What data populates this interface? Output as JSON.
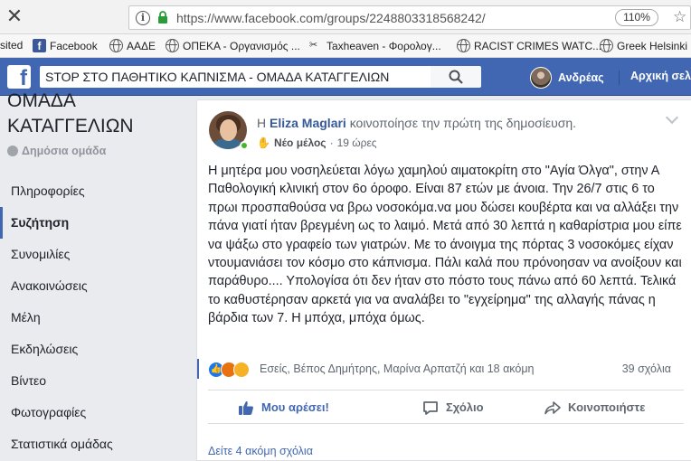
{
  "browser": {
    "url": "https://www.facebook.com/groups/2248803318568242/",
    "zoom": "110%",
    "bookmarks": [
      {
        "label": "sited",
        "icon": "none"
      },
      {
        "label": "Facebook",
        "icon": "facebook-icon"
      },
      {
        "label": "ΑΑΔΕ",
        "icon": "globe-icon"
      },
      {
        "label": "ΟΠΕΚΑ - Οργανισμός ...",
        "icon": "globe-icon"
      },
      {
        "label": "Taxheaven - Φορολογ...",
        "icon": "taxheaven-icon"
      },
      {
        "label": "RACIST CRIMES WATC...",
        "icon": "globe-icon"
      },
      {
        "label": "Greek Helsinki M",
        "icon": "globe-icon"
      }
    ]
  },
  "topbar": {
    "logo": "f",
    "search_value": "STOP ΣΤΟ ΠΑΘΗΤΙΚΟ ΚΑΠΝΙΣΜΑ - ΟΜΑΔΑ ΚΑΤΑΓΓΕΛΙΩΝ",
    "user_name": "Ανδρέας",
    "home_label": "Αρχική σελ",
    "brand_color": "#4267b2"
  },
  "sidebar": {
    "group_title": "ΟΜΑΔΑ ΚΑΤΑΓΓΕΛΙΩΝ",
    "group_type": "Δημόσια ομάδα",
    "items": [
      {
        "label": "Πληροφορίες",
        "active": false
      },
      {
        "label": "Συζήτηση",
        "active": true
      },
      {
        "label": "Συνομιλίες",
        "active": false
      },
      {
        "label": "Ανακοινώσεις",
        "active": false
      },
      {
        "label": "Μέλη",
        "active": false
      },
      {
        "label": "Εκδηλώσεις",
        "active": false
      },
      {
        "label": "Βίντεο",
        "active": false
      },
      {
        "label": "Φωτογραφίες",
        "active": false
      },
      {
        "label": "Στατιστικά ομάδας",
        "active": false
      }
    ]
  },
  "post": {
    "prefix": "Η",
    "author": "Eliza Maglari",
    "action_text": "κοινοποίησε την πρώτη της δημοσίευση.",
    "badge": "Νέο μέλος",
    "separator": "·",
    "time": "19 ώρες",
    "body": "Η μητέρα μου νοσηλεύεται λόγω χαμηλού αιματοκρίτη στο \"Αγία Όλγα\", στην Α Παθολογική κλινική στον 6ο όροφο. Είναι 87 ετών με άνοια. Την 26/7 στις 6 το πρωι προσπαθούσα να βρω νοσοκόμα.να μου δώσει κουβέρτα και να αλλάξει την πάνα γιατί ήταν βρεγμένη ως το λαιμό. Μετά από 30 λεπτά η καθαρίστρια μου είπε να ψάξω στο γραφείο των γιατρών. Με το άνοιγμα της πόρτας 3 νοσοκόμες είχαν ντουμανιάσει τον κόσμο στο κάπνισμα. Πάλι καλά που πρόνοησαν να ανοίξουν και παράθυρο.... Υπολογίσα ότι δεν ήταν στο πόστο τους πάνω από 60 λεπτά. Τελικά το καθυστέρησαν αρκετά για να αναλάβει το \"εγχείρημα\" της αλλαγής πάνας η βάρδια των 7. Η μπόχα, μπόχα όμως.",
    "reactions_text": "Εσείς, Βέπος Δημήτρης, Μαρίνα Αρπατζή και 18 ακόμη",
    "comments_count": "39 σχόλια",
    "like_label": "Μου αρέσει!",
    "comment_label": "Σχόλιο",
    "share_label": "Κοινοποιήστε",
    "more_comments": "Δείτε 4 ακόμη σχόλια"
  }
}
